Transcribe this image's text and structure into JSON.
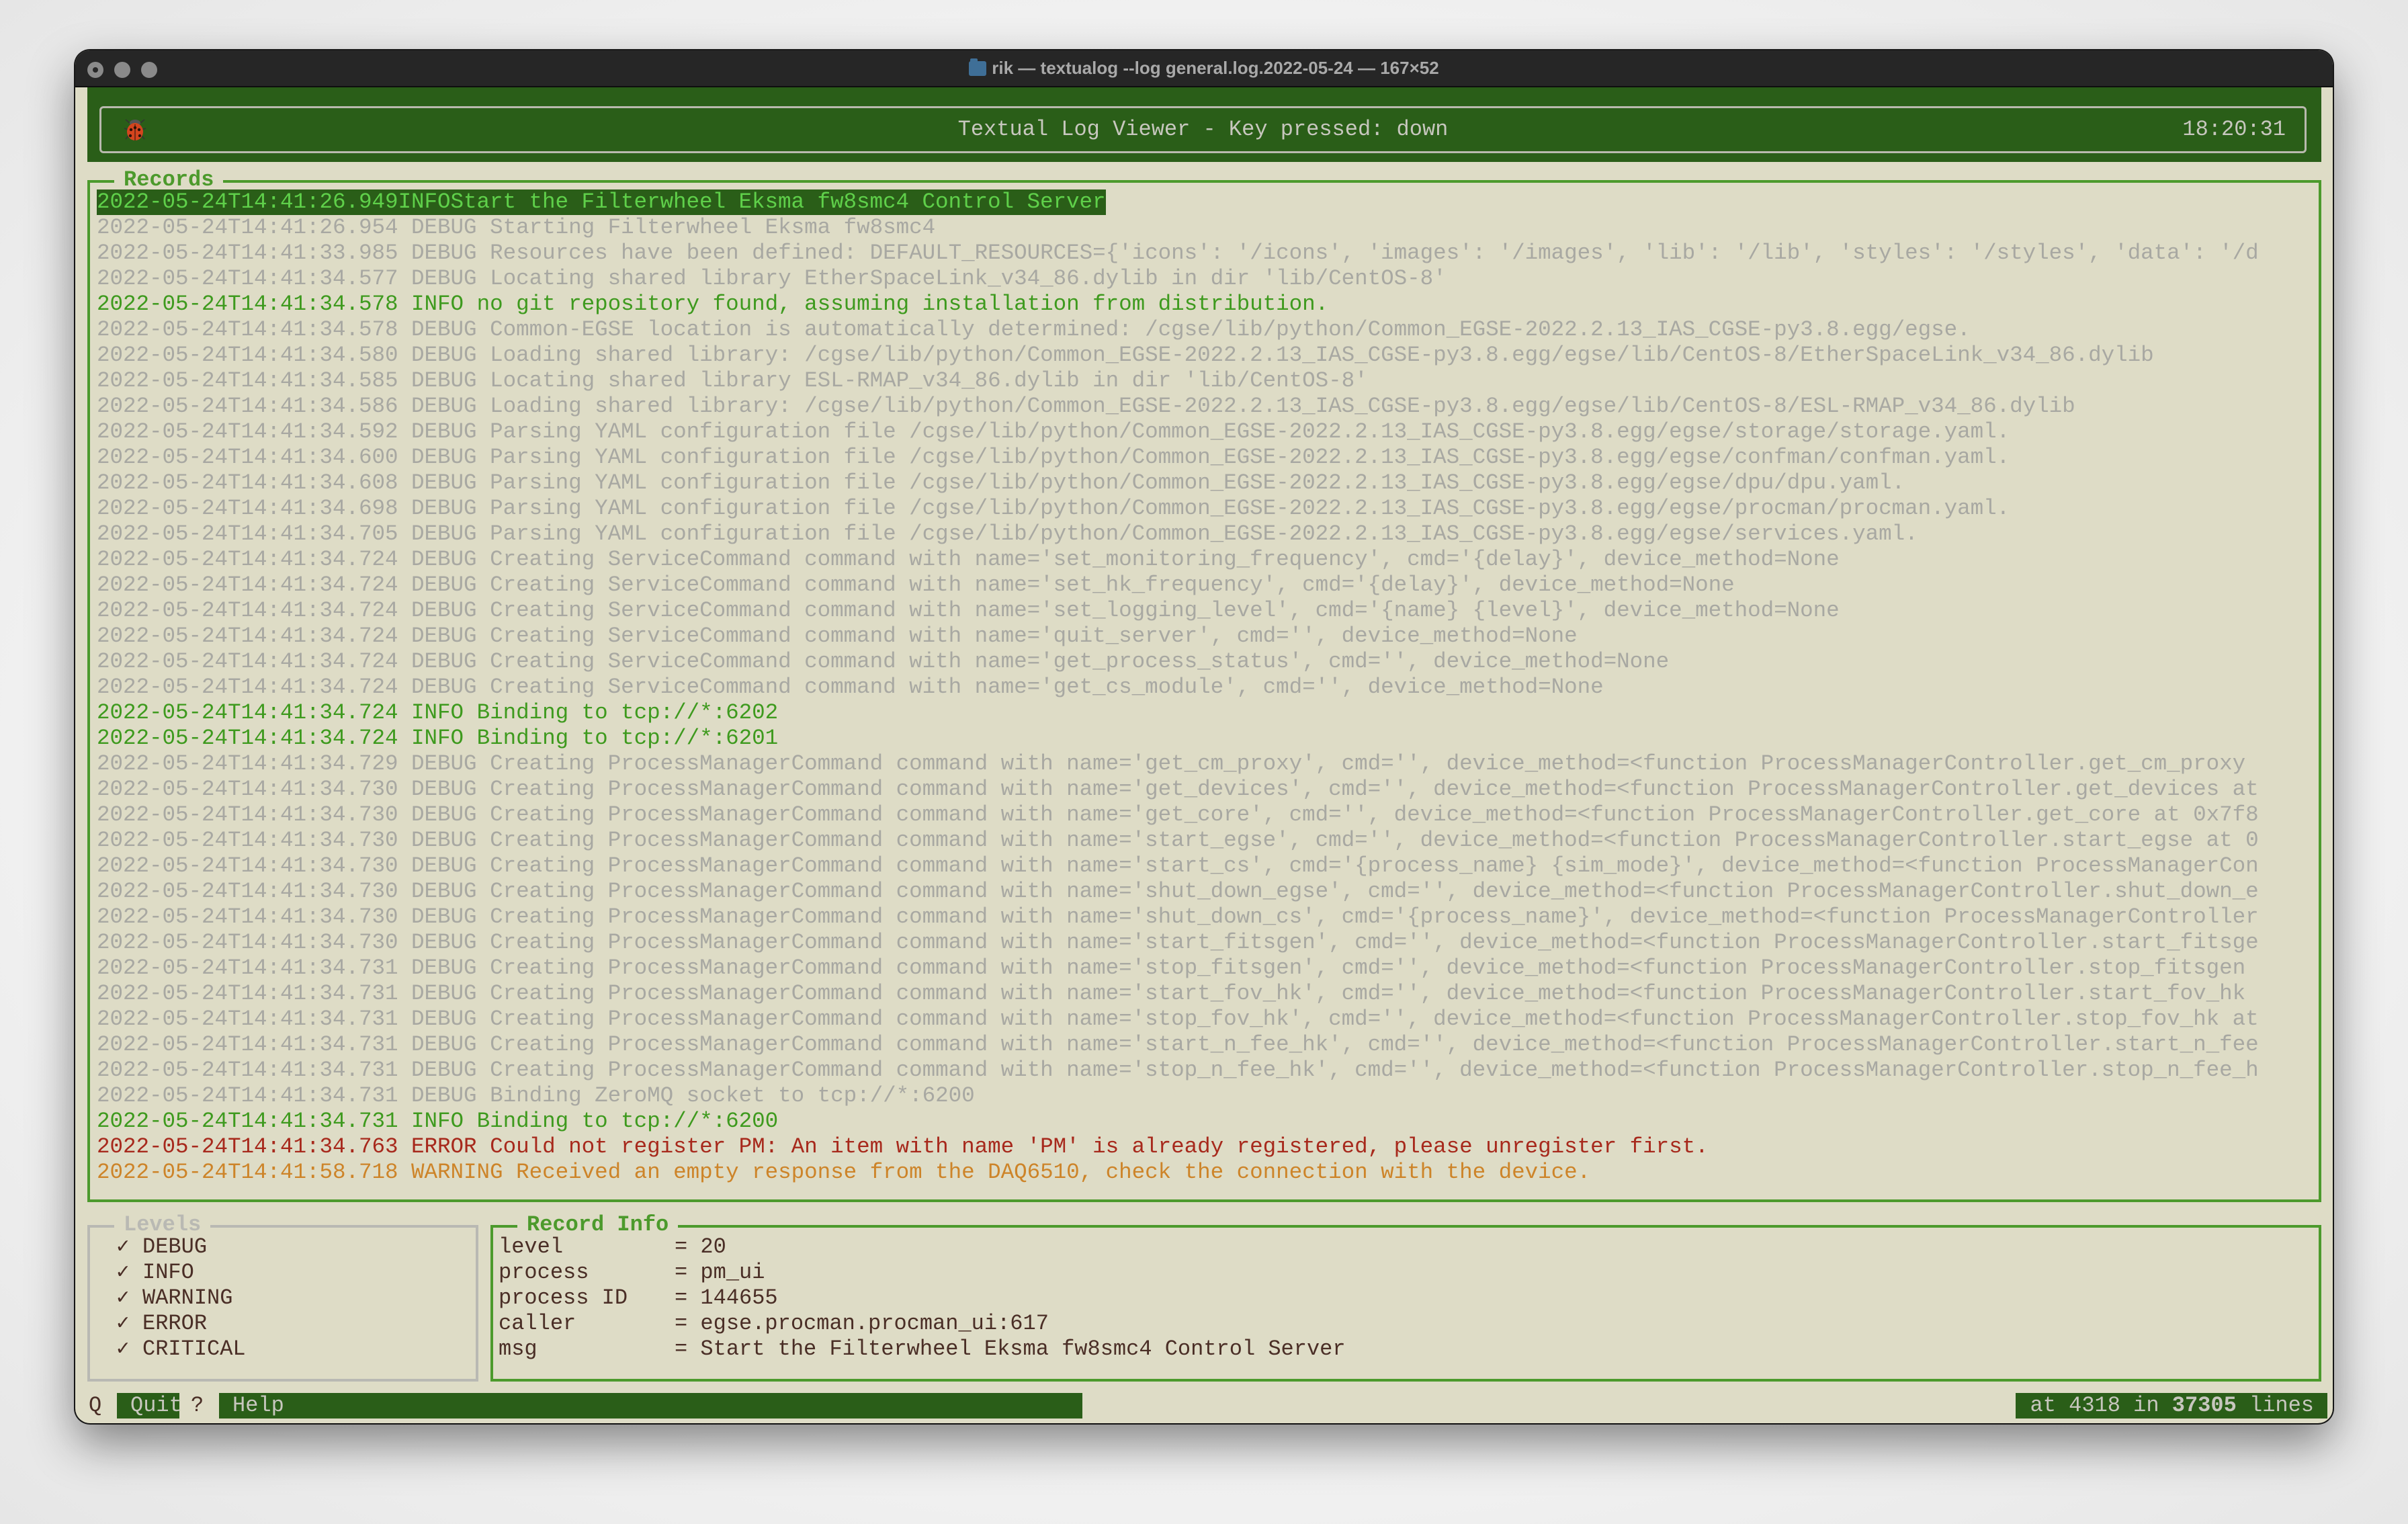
{
  "window": {
    "title": "rik — textualog --log general.log.2022-05-24 — 167×52",
    "folder_icon": "home-folder-icon"
  },
  "header": {
    "icon": "ladybug-icon",
    "title": "Textual Log Viewer - Key pressed: down",
    "clock": "18:20:31"
  },
  "colors": {
    "header_bg": "#2a5e18",
    "panel_bg": "#dedcc6",
    "border_green": "#4c9a2c",
    "debug": "#a8a8a2",
    "info": "#3e9a1e",
    "error": "#a7291c",
    "warning": "#cd8429",
    "selected_fg": "#5fd04a"
  },
  "records": {
    "title": "Records",
    "selected_index": 0,
    "lines": [
      {
        "ts": "2022-05-24T14:41:26.949",
        "level": "INFO",
        "msg": "Start the Filterwheel Eksma fw8smc4 Control Server"
      },
      {
        "ts": "2022-05-24T14:41:26.954",
        "level": "DEBUG",
        "msg": "Starting Filterwheel Eksma fw8smc4"
      },
      {
        "ts": "2022-05-24T14:41:33.985",
        "level": "DEBUG",
        "msg": "Resources have been defined: DEFAULT_RESOURCES={'icons': '/icons', 'images': '/images', 'lib': '/lib', 'styles': '/styles', 'data': '/d"
      },
      {
        "ts": "2022-05-24T14:41:34.577",
        "level": "DEBUG",
        "msg": "Locating shared library EtherSpaceLink_v34_86.dylib in dir 'lib/CentOS-8'"
      },
      {
        "ts": "2022-05-24T14:41:34.578",
        "level": "INFO",
        "msg": "no git repository found, assuming installation from distribution."
      },
      {
        "ts": "2022-05-24T14:41:34.578",
        "level": "DEBUG",
        "msg": "Common-EGSE location is automatically determined: /cgse/lib/python/Common_EGSE-2022.2.13_IAS_CGSE-py3.8.egg/egse."
      },
      {
        "ts": "2022-05-24T14:41:34.580",
        "level": "DEBUG",
        "msg": "Loading shared library: /cgse/lib/python/Common_EGSE-2022.2.13_IAS_CGSE-py3.8.egg/egse/lib/CentOS-8/EtherSpaceLink_v34_86.dylib"
      },
      {
        "ts": "2022-05-24T14:41:34.585",
        "level": "DEBUG",
        "msg": "Locating shared library ESL-RMAP_v34_86.dylib in dir 'lib/CentOS-8'"
      },
      {
        "ts": "2022-05-24T14:41:34.586",
        "level": "DEBUG",
        "msg": "Loading shared library: /cgse/lib/python/Common_EGSE-2022.2.13_IAS_CGSE-py3.8.egg/egse/lib/CentOS-8/ESL-RMAP_v34_86.dylib"
      },
      {
        "ts": "2022-05-24T14:41:34.592",
        "level": "DEBUG",
        "msg": "Parsing YAML configuration file /cgse/lib/python/Common_EGSE-2022.2.13_IAS_CGSE-py3.8.egg/egse/storage/storage.yaml."
      },
      {
        "ts": "2022-05-24T14:41:34.600",
        "level": "DEBUG",
        "msg": "Parsing YAML configuration file /cgse/lib/python/Common_EGSE-2022.2.13_IAS_CGSE-py3.8.egg/egse/confman/confman.yaml."
      },
      {
        "ts": "2022-05-24T14:41:34.608",
        "level": "DEBUG",
        "msg": "Parsing YAML configuration file /cgse/lib/python/Common_EGSE-2022.2.13_IAS_CGSE-py3.8.egg/egse/dpu/dpu.yaml."
      },
      {
        "ts": "2022-05-24T14:41:34.698",
        "level": "DEBUG",
        "msg": "Parsing YAML configuration file /cgse/lib/python/Common_EGSE-2022.2.13_IAS_CGSE-py3.8.egg/egse/procman/procman.yaml."
      },
      {
        "ts": "2022-05-24T14:41:34.705",
        "level": "DEBUG",
        "msg": "Parsing YAML configuration file /cgse/lib/python/Common_EGSE-2022.2.13_IAS_CGSE-py3.8.egg/egse/services.yaml."
      },
      {
        "ts": "2022-05-24T14:41:34.724",
        "level": "DEBUG",
        "msg": "Creating ServiceCommand command with name='set_monitoring_frequency', cmd='{delay}', device_method=None"
      },
      {
        "ts": "2022-05-24T14:41:34.724",
        "level": "DEBUG",
        "msg": "Creating ServiceCommand command with name='set_hk_frequency', cmd='{delay}', device_method=None"
      },
      {
        "ts": "2022-05-24T14:41:34.724",
        "level": "DEBUG",
        "msg": "Creating ServiceCommand command with name='set_logging_level', cmd='{name} {level}', device_method=None"
      },
      {
        "ts": "2022-05-24T14:41:34.724",
        "level": "DEBUG",
        "msg": "Creating ServiceCommand command with name='quit_server', cmd='', device_method=None"
      },
      {
        "ts": "2022-05-24T14:41:34.724",
        "level": "DEBUG",
        "msg": "Creating ServiceCommand command with name='get_process_status', cmd='', device_method=None"
      },
      {
        "ts": "2022-05-24T14:41:34.724",
        "level": "DEBUG",
        "msg": "Creating ServiceCommand command with name='get_cs_module', cmd='', device_method=None"
      },
      {
        "ts": "2022-05-24T14:41:34.724",
        "level": "INFO",
        "msg": "Binding to tcp://*:6202"
      },
      {
        "ts": "2022-05-24T14:41:34.724",
        "level": "INFO",
        "msg": "Binding to tcp://*:6201"
      },
      {
        "ts": "2022-05-24T14:41:34.729",
        "level": "DEBUG",
        "msg": "Creating ProcessManagerCommand command with name='get_cm_proxy', cmd='', device_method=<function ProcessManagerController.get_cm_proxy"
      },
      {
        "ts": "2022-05-24T14:41:34.730",
        "level": "DEBUG",
        "msg": "Creating ProcessManagerCommand command with name='get_devices', cmd='', device_method=<function ProcessManagerController.get_devices at"
      },
      {
        "ts": "2022-05-24T14:41:34.730",
        "level": "DEBUG",
        "msg": "Creating ProcessManagerCommand command with name='get_core', cmd='', device_method=<function ProcessManagerController.get_core at 0x7f8"
      },
      {
        "ts": "2022-05-24T14:41:34.730",
        "level": "DEBUG",
        "msg": "Creating ProcessManagerCommand command with name='start_egse', cmd='', device_method=<function ProcessManagerController.start_egse at 0"
      },
      {
        "ts": "2022-05-24T14:41:34.730",
        "level": "DEBUG",
        "msg": "Creating ProcessManagerCommand command with name='start_cs', cmd='{process_name} {sim_mode}', device_method=<function ProcessManagerCon"
      },
      {
        "ts": "2022-05-24T14:41:34.730",
        "level": "DEBUG",
        "msg": "Creating ProcessManagerCommand command with name='shut_down_egse', cmd='', device_method=<function ProcessManagerController.shut_down_e"
      },
      {
        "ts": "2022-05-24T14:41:34.730",
        "level": "DEBUG",
        "msg": "Creating ProcessManagerCommand command with name='shut_down_cs', cmd='{process_name}', device_method=<function ProcessManagerController"
      },
      {
        "ts": "2022-05-24T14:41:34.730",
        "level": "DEBUG",
        "msg": "Creating ProcessManagerCommand command with name='start_fitsgen', cmd='', device_method=<function ProcessManagerController.start_fitsge"
      },
      {
        "ts": "2022-05-24T14:41:34.731",
        "level": "DEBUG",
        "msg": "Creating ProcessManagerCommand command with name='stop_fitsgen', cmd='', device_method=<function ProcessManagerController.stop_fitsgen"
      },
      {
        "ts": "2022-05-24T14:41:34.731",
        "level": "DEBUG",
        "msg": "Creating ProcessManagerCommand command with name='start_fov_hk', cmd='', device_method=<function ProcessManagerController.start_fov_hk"
      },
      {
        "ts": "2022-05-24T14:41:34.731",
        "level": "DEBUG",
        "msg": "Creating ProcessManagerCommand command with name='stop_fov_hk', cmd='', device_method=<function ProcessManagerController.stop_fov_hk at"
      },
      {
        "ts": "2022-05-24T14:41:34.731",
        "level": "DEBUG",
        "msg": "Creating ProcessManagerCommand command with name='start_n_fee_hk', cmd='', device_method=<function ProcessManagerController.start_n_fee"
      },
      {
        "ts": "2022-05-24T14:41:34.731",
        "level": "DEBUG",
        "msg": "Creating ProcessManagerCommand command with name='stop_n_fee_hk', cmd='', device_method=<function ProcessManagerController.stop_n_fee_h"
      },
      {
        "ts": "2022-05-24T14:41:34.731",
        "level": "DEBUG",
        "msg": "Binding ZeroMQ socket to tcp://*:6200"
      },
      {
        "ts": "2022-05-24T14:41:34.731",
        "level": "INFO",
        "msg": "Binding to tcp://*:6200"
      },
      {
        "ts": "2022-05-24T14:41:34.763",
        "level": "ERROR",
        "msg": "Could not register PM: An item with name 'PM' is already registered, please unregister first."
      },
      {
        "ts": "2022-05-24T14:41:58.718",
        "level": "WARNING",
        "msg": "Received an empty response from the DAQ6510, check the connection with the device."
      }
    ]
  },
  "levels": {
    "title": "Levels",
    "check_glyph": "✓",
    "items": [
      {
        "label": "DEBUG",
        "checked": true
      },
      {
        "label": "INFO",
        "checked": true
      },
      {
        "label": "WARNING",
        "checked": true
      },
      {
        "label": "ERROR",
        "checked": true
      },
      {
        "label": "CRITICAL",
        "checked": true
      }
    ]
  },
  "record_info": {
    "title": "Record Info",
    "rows": [
      {
        "key": "level",
        "value": "20"
      },
      {
        "key": "process",
        "value": "pm_ui"
      },
      {
        "key": "process ID",
        "value": "144655"
      },
      {
        "key": "caller",
        "value": "egse.procman.procman_ui:617"
      },
      {
        "key": "msg",
        "value": "Start the Filterwheel Eksma fw8smc4 Control Server"
      }
    ]
  },
  "footer": {
    "quit_key": "Q",
    "quit_label": "Quit",
    "help_key": "?",
    "help_label": "Help",
    "status_prefix": "at",
    "current_line": "4318",
    "status_mid": "in",
    "total_lines": "37305",
    "status_suffix": "lines"
  }
}
